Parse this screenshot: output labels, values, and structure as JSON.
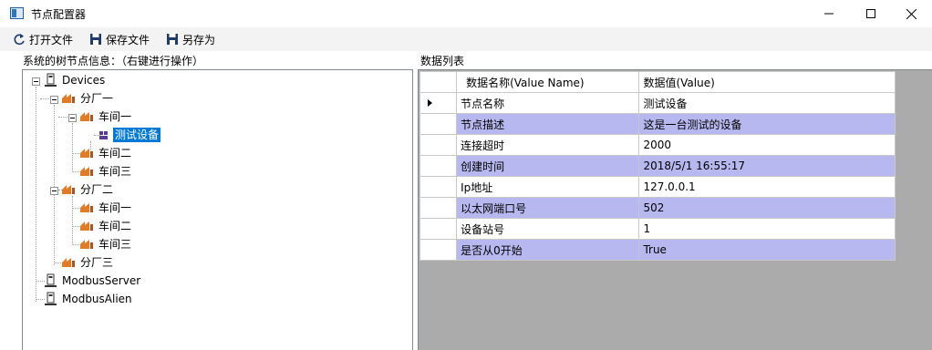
{
  "window": {
    "title": "节点配置器",
    "minimize_icon": "minimize-icon",
    "maximize_icon": "maximize-icon",
    "close_icon": "close-icon"
  },
  "toolbar": {
    "open_label": "打开文件",
    "save_label": "保存文件",
    "save_as_label": "另存为"
  },
  "tree_panel": {
    "label": "系统的树节点信息：（右键进行操作）",
    "nodes": {
      "root": "Devices",
      "f1": "分厂一",
      "f1_w1": "车间一",
      "f1_w1_dev": "测试设备",
      "f1_w2": "车间二",
      "f1_w3": "车间三",
      "f2": "分厂二",
      "f2_w1": "车间一",
      "f2_w2": "车间二",
      "f2_w3": "车间三",
      "f3": "分厂三",
      "modbus_server": "ModbusServer",
      "modbus_alien": "ModbusAlien"
    }
  },
  "grid_panel": {
    "label": "数据列表",
    "columns": {
      "name": "数据名称(Value Name)",
      "value": "数据值(Value)"
    },
    "rows": [
      {
        "name": "节点名称",
        "value": "测试设备"
      },
      {
        "name": "节点描述",
        "value": "这是一台测试的设备"
      },
      {
        "name": "连接超时",
        "value": "2000"
      },
      {
        "name": "创建时间",
        "value": "2018/5/1 16:55:17"
      },
      {
        "name": "Ip地址",
        "value": "127.0.0.1"
      },
      {
        "name": "以太网端口号",
        "value": "502"
      },
      {
        "name": "设备站号",
        "value": "1"
      },
      {
        "name": "是否从0开始",
        "value": "True"
      }
    ]
  },
  "colors": {
    "selection": "#0078d7",
    "alt_row": "#b8b8f0",
    "grid_background": "#ababab"
  }
}
